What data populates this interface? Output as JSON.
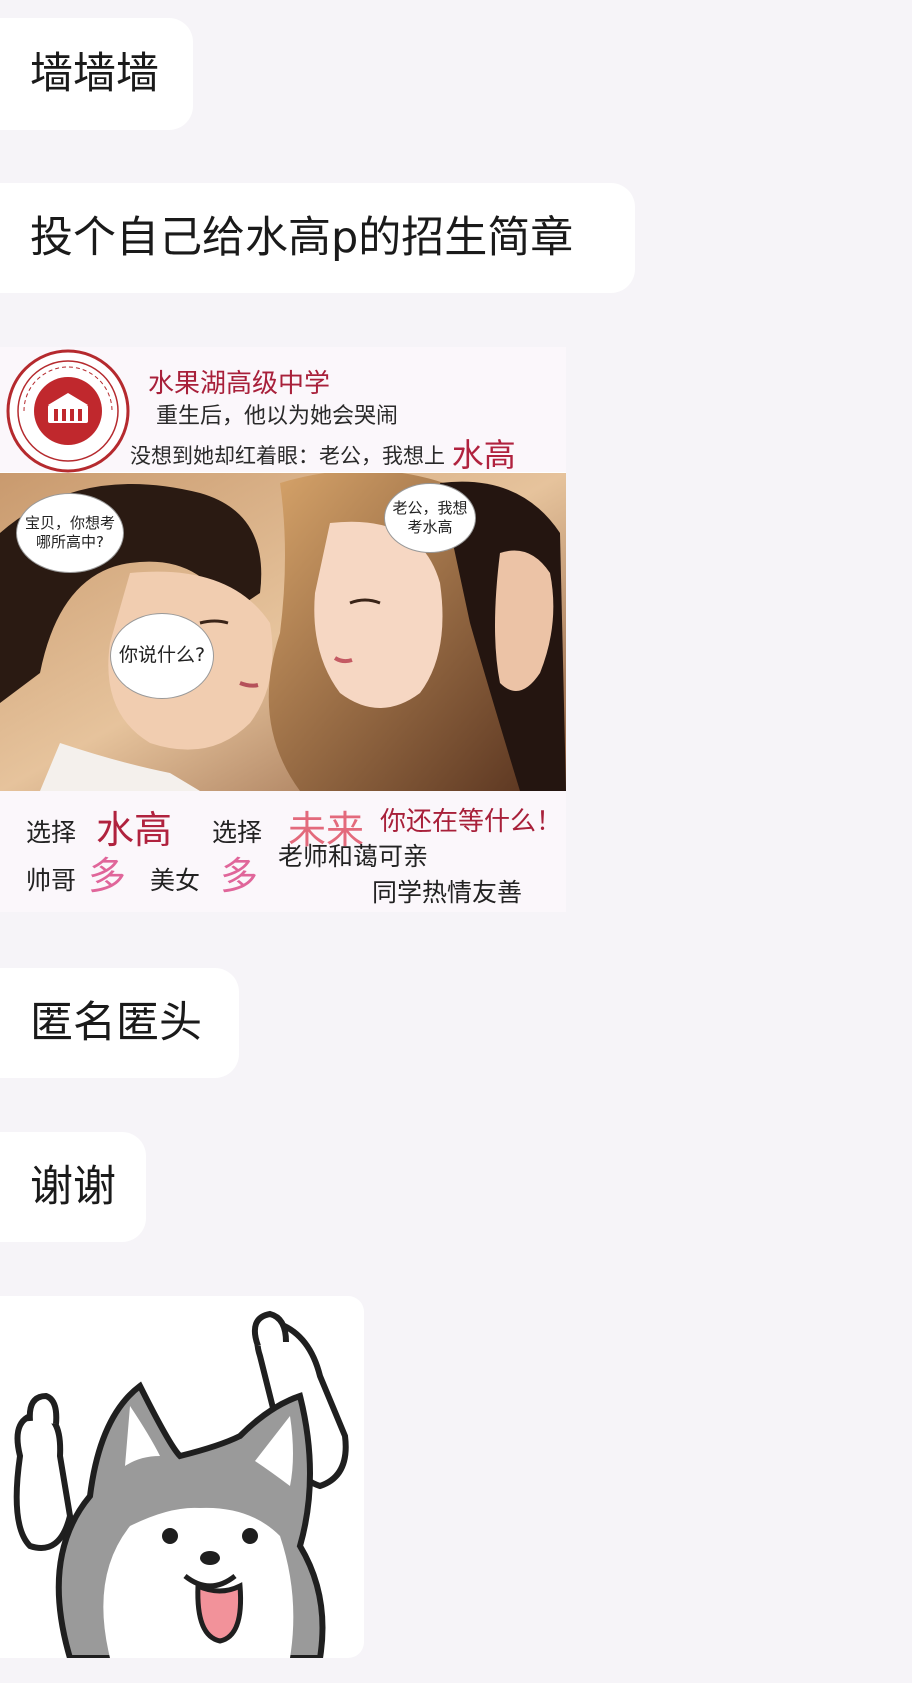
{
  "messages": {
    "m1": "墙墙墙",
    "m2": "投个自己给水高p的招生简章",
    "m3": "匿名匿头",
    "m4": "谢谢"
  },
  "poster": {
    "school_name": "水果湖高级中学",
    "line1": "重生后，他以为她会哭闹",
    "line2_prefix": "没想到她却红着眼：老公，我想上",
    "line2_highlight": "水高",
    "bubble_boy": "宝贝，你想考哪所高中?",
    "bubble_girl_question": "你说什么?",
    "bubble_girl": "老公，我想考水高",
    "footer": {
      "choose1": "选择",
      "shuigao": "水高",
      "choose2": "选择",
      "future": "未来",
      "waiting": "你还在等什么！",
      "handsome": "帅哥",
      "many1": "多",
      "beauty": "美女",
      "many2": "多",
      "teachers": "老师和蔼可亲",
      "classmates": "同学热情友善"
    }
  },
  "colors": {
    "background": "#f6f4f8",
    "bubble": "#ffffff",
    "accent_red": "#b0223e",
    "accent_pink": "#e0669a"
  }
}
